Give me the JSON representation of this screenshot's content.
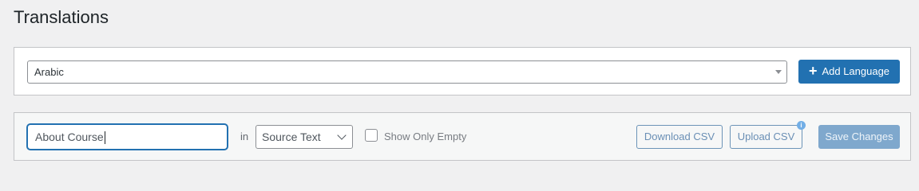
{
  "page": {
    "title": "Translations"
  },
  "language_panel": {
    "selected_language": "Arabic",
    "add_language_label": "Add Language",
    "add_icon": "plus-icon"
  },
  "filter_panel": {
    "search_value": "About Course",
    "in_label": "in",
    "scope_selected": "Source Text",
    "show_only_empty_label": "Show Only Empty",
    "show_only_empty_checked": false,
    "download_csv_label": "Download CSV",
    "upload_csv_label": "Upload CSV",
    "upload_info_icon": "info-icon",
    "save_changes_label": "Save Changes"
  },
  "colors": {
    "primary": "#2271b1",
    "background": "#f0f0f1",
    "disabled_primary": "#7fa8cd"
  }
}
